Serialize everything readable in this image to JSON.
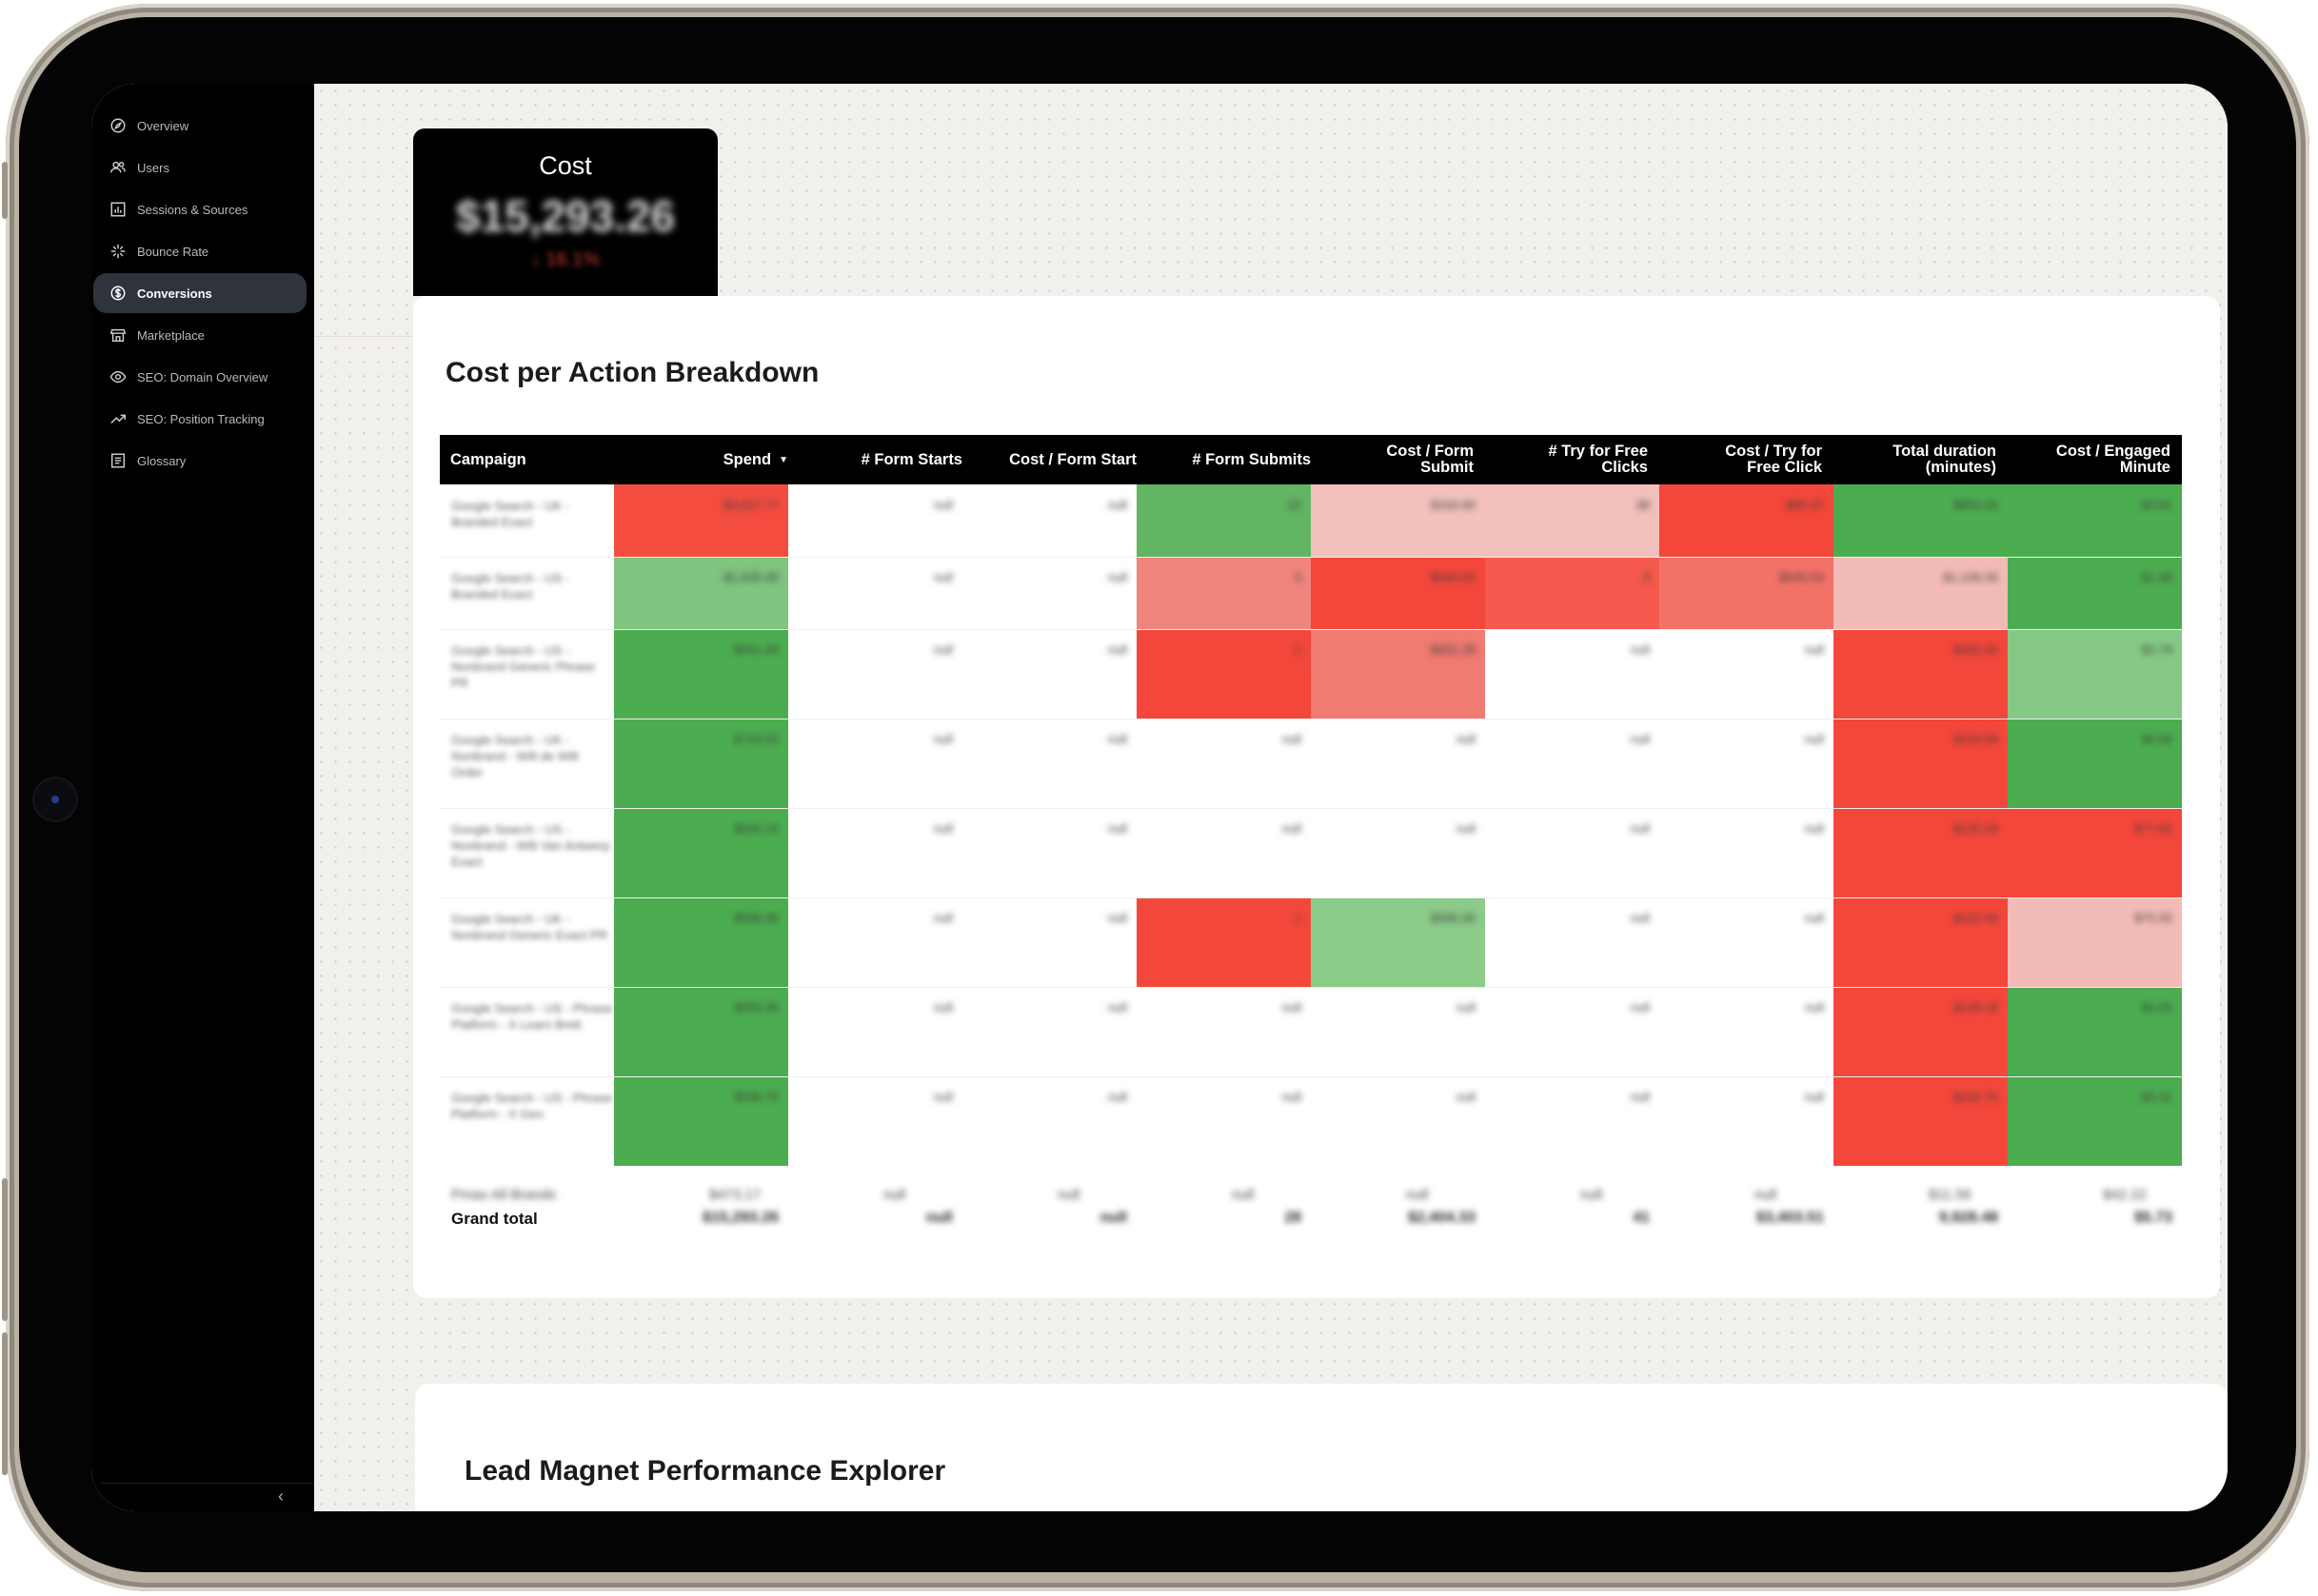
{
  "sidebar": {
    "items": [
      {
        "label": "Overview",
        "icon": "compass-icon",
        "active": false
      },
      {
        "label": "Users",
        "icon": "users-icon",
        "active": false
      },
      {
        "label": "Sessions & Sources",
        "icon": "bar-chart-icon",
        "active": false
      },
      {
        "label": "Bounce Rate",
        "icon": "bounce-icon",
        "active": false
      },
      {
        "label": "Conversions",
        "icon": "dollar-circle-icon",
        "active": true
      },
      {
        "label": "Marketplace",
        "icon": "store-icon",
        "active": false
      },
      {
        "label": "SEO: Domain Overview",
        "icon": "eye-icon",
        "active": false
      },
      {
        "label": "SEO: Position Tracking",
        "icon": "trend-up-icon",
        "active": false
      },
      {
        "label": "Glossary",
        "icon": "book-icon",
        "active": false
      }
    ],
    "collapse_icon": "chevron-left-icon"
  },
  "kpi": {
    "label": "Cost",
    "value": "$15,293.26",
    "delta": "↓ 16.1%",
    "value_note": "blurred in screenshot"
  },
  "breakdown": {
    "title": "Cost per Action Breakdown",
    "columns": [
      "Campaign",
      "Spend",
      "# Form Starts",
      "Cost / Form Start",
      "# Form Submits",
      "Cost / Form Submit",
      "# Try for Free Clicks",
      "Cost / Try for Free Click",
      "Total duration (minutes)",
      "Cost / Engaged Minute"
    ],
    "sort_indicator": "▼",
    "rows": [
      {
        "campaign": "Google Search - UK - Branded Exact",
        "cells": [
          "$3,627.77",
          "null",
          "null",
          "22",
          "$164.90",
          "38",
          "$95.47",
          "$953.33",
          "$3.81"
        ],
        "colors": [
          "#f44d40",
          "#ffffff",
          "#ffffff",
          "#61b563",
          "#f2c1bc",
          "#f1c0bb",
          "#f4473b",
          "#4cad50",
          "#4cad50"
        ]
      },
      {
        "campaign": "Google Search - US - Branded Exact",
        "cells": [
          "$1,635.09",
          "null",
          "null",
          "3",
          "$545.03",
          "3",
          "$545.03",
          "$1,106.56",
          "$1.48"
        ],
        "colors": [
          "#7fc47f",
          "#ffffff",
          "#ffffff",
          "#ef857d",
          "#f4473b",
          "#f5584c",
          "#f37268",
          "#f3bbb5",
          "#4cad50"
        ]
      },
      {
        "campaign": "Google Search - US - Nonbrand Generic Phrase PR",
        "cells": [
          "$931.28",
          "null",
          "null",
          "1",
          "$931.28",
          "null",
          "null",
          "$333.20",
          "$2.79"
        ],
        "colors": [
          "#4cad50",
          "#ffffff",
          "#ffffff",
          "#f4473b",
          "#ef7b72",
          "#ffffff",
          "#ffffff",
          "#f4473b",
          "#86c986"
        ]
      },
      {
        "campaign": "Google Search - UK - Nonbrand - Wilt de Wilt Order",
        "cells": [
          "$715.55",
          "null",
          "null",
          "null",
          "null",
          "null",
          "null",
          "$153.58",
          "$4.66"
        ],
        "colors": [
          "#4cad50",
          "#ffffff",
          "#ffffff",
          "#ffffff",
          "#ffffff",
          "#ffffff",
          "#ffffff",
          "#f4473b",
          "#4cad50"
        ]
      },
      {
        "campaign": "Google Search - US - Nonbrand - Wilt Van Antwerp Exact",
        "cells": [
          "$626.19",
          "null",
          "null",
          "null",
          "null",
          "null",
          "null",
          "$125.33",
          "$77.62"
        ],
        "colors": [
          "#4cad50",
          "#ffffff",
          "#ffffff",
          "#ffffff",
          "#ffffff",
          "#ffffff",
          "#ffffff",
          "#f4473b",
          "#f4473b"
        ]
      },
      {
        "campaign": "Google Search - UK - Nonbrand Generic Exact PR",
        "cells": [
          "$596.06",
          "null",
          "null",
          "1",
          "$596.06",
          "null",
          "null",
          "$122.59",
          "$75.50"
        ],
        "colors": [
          "#4cad50",
          "#ffffff",
          "#ffffff",
          "#f4473b",
          "#8ccb88",
          "#ffffff",
          "#ffffff",
          "#f4473b",
          "#f3bbb5"
        ]
      },
      {
        "campaign": "Google Search - US - Phrase Platform - X Learn Brett",
        "cells": [
          "$559.36",
          "null",
          "null",
          "null",
          "null",
          "null",
          "null",
          "$139.18",
          "$4.05"
        ],
        "colors": [
          "#4cad50",
          "#ffffff",
          "#ffffff",
          "#ffffff",
          "#ffffff",
          "#ffffff",
          "#ffffff",
          "#f4473b",
          "#4cad50"
        ]
      },
      {
        "campaign": "Google Search - US - Phrase Platform - X Gen",
        "cells": [
          "$536.70",
          "null",
          "null",
          "null",
          "null",
          "null",
          "null",
          "$132.70",
          "$3.31"
        ],
        "colors": [
          "#4cad50",
          "#ffffff",
          "#ffffff",
          "#ffffff",
          "#ffffff",
          "#ffffff",
          "#ffffff",
          "#f4473b",
          "#4cad50"
        ]
      }
    ],
    "partial_row": {
      "campaign": "Pmax All Brands",
      "cells": [
        "$473.17",
        "null",
        "null",
        "null",
        "null",
        "null",
        "null",
        "$11.56",
        "$42.22"
      ]
    },
    "grand_total": {
      "label": "Grand total",
      "cells": [
        "$15,293.26",
        "null",
        "null",
        "28",
        "$2,404.33",
        "41",
        "$3,403.51",
        "9,928.48",
        "$5.73"
      ]
    }
  },
  "lead_magnet": {
    "title": "Lead Magnet Performance Explorer"
  }
}
